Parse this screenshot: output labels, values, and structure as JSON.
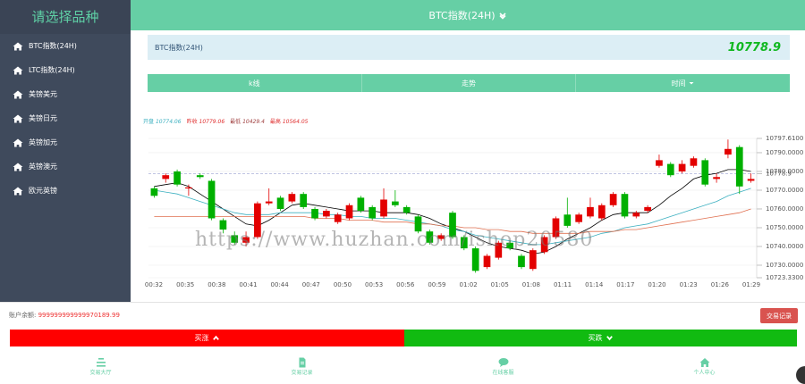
{
  "sidebar": {
    "title": "请选择品种",
    "items": [
      {
        "label": "BTC指数(24H)"
      },
      {
        "label": "LTC指数(24H)"
      },
      {
        "label": "美镑美元"
      },
      {
        "label": "美镑日元"
      },
      {
        "label": "英镑加元"
      },
      {
        "label": "英镑澳元"
      },
      {
        "label": "欧元英镑"
      }
    ]
  },
  "header": {
    "title": "BTC指数(24H)"
  },
  "info": {
    "name": "BTC指数(24H)",
    "price": "10778.9"
  },
  "tabs": [
    {
      "label": "k线"
    },
    {
      "label": "走势"
    },
    {
      "label": "时间"
    }
  ],
  "stats": {
    "open_label": "开盘",
    "open": "10774.06",
    "close_label": "昨收",
    "close": "10779.06",
    "low_label": "最低",
    "low": "10429.4",
    "high_label": "最高",
    "high": "10564.05"
  },
  "chart_data": {
    "type": "candlestick",
    "x_ticks": [
      "00:32",
      "00:35",
      "00:38",
      "00:41",
      "00:44",
      "00:47",
      "00:50",
      "00:53",
      "00:56",
      "00:59",
      "01:02",
      "01:05",
      "01:08",
      "01:11",
      "01:14",
      "01:17",
      "01:20",
      "01:23",
      "01:26",
      "01:29"
    ],
    "y_ticks": [
      "10797.6100",
      "10790.0000",
      "10780.0000",
      "10778.9",
      "10770.0000",
      "10760.0000",
      "10750.0000",
      "10740.0000",
      "10730.0000",
      "10723.3300"
    ],
    "ylim": [
      10723.33,
      10797.61
    ],
    "current": 10778.9,
    "up_color": "#e30000",
    "down_color": "#00b000",
    "candles": [
      {
        "o": 10771,
        "c": 10767,
        "h": 10772,
        "l": 10766
      },
      {
        "o": 10776,
        "c": 10778,
        "h": 10779,
        "l": 10774
      },
      {
        "o": 10780,
        "c": 10773,
        "h": 10781,
        "l": 10772
      },
      {
        "o": 10771,
        "c": 10771.5,
        "h": 10773,
        "l": 10767
      },
      {
        "o": 10778,
        "c": 10777,
        "h": 10779,
        "l": 10776
      },
      {
        "o": 10775,
        "c": 10755,
        "h": 10776,
        "l": 10754
      },
      {
        "o": 10754,
        "c": 10749,
        "h": 10755,
        "l": 10747
      },
      {
        "o": 10746,
        "c": 10742,
        "h": 10748,
        "l": 10741
      },
      {
        "o": 10742,
        "c": 10745,
        "h": 10748,
        "l": 10740
      },
      {
        "o": 10745,
        "c": 10763,
        "h": 10764,
        "l": 10744
      },
      {
        "o": 10763,
        "c": 10764,
        "h": 10771,
        "l": 10762
      },
      {
        "o": 10766,
        "c": 10760,
        "h": 10767,
        "l": 10759
      },
      {
        "o": 10764,
        "c": 10768,
        "h": 10769,
        "l": 10763
      },
      {
        "o": 10768,
        "c": 10761,
        "h": 10769,
        "l": 10760
      },
      {
        "o": 10760,
        "c": 10755,
        "h": 10761,
        "l": 10754
      },
      {
        "o": 10756,
        "c": 10759,
        "h": 10760,
        "l": 10755
      },
      {
        "o": 10753,
        "c": 10757,
        "h": 10758,
        "l": 10752
      },
      {
        "o": 10755,
        "c": 10762,
        "h": 10763,
        "l": 10754
      },
      {
        "o": 10766,
        "c": 10759,
        "h": 10767,
        "l": 10758
      },
      {
        "o": 10761,
        "c": 10755,
        "h": 10762,
        "l": 10754
      },
      {
        "o": 10756,
        "c": 10765,
        "h": 10771,
        "l": 10755
      },
      {
        "o": 10764,
        "c": 10762,
        "h": 10770,
        "l": 10761
      },
      {
        "o": 10761,
        "c": 10758,
        "h": 10762,
        "l": 10757
      },
      {
        "o": 10756,
        "c": 10748,
        "h": 10757,
        "l": 10747
      },
      {
        "o": 10748,
        "c": 10742,
        "h": 10749,
        "l": 10741
      },
      {
        "o": 10744,
        "c": 10746,
        "h": 10747,
        "l": 10743
      },
      {
        "o": 10758,
        "c": 10745,
        "h": 10759,
        "l": 10744
      },
      {
        "o": 10745,
        "c": 10739,
        "h": 10746,
        "l": 10738
      },
      {
        "o": 10739,
        "c": 10727,
        "h": 10740,
        "l": 10726
      },
      {
        "o": 10729,
        "c": 10735,
        "h": 10736,
        "l": 10728
      },
      {
        "o": 10734,
        "c": 10742,
        "h": 10743,
        "l": 10733
      },
      {
        "o": 10742,
        "c": 10739,
        "h": 10743,
        "l": 10738
      },
      {
        "o": 10735,
        "c": 10729,
        "h": 10736,
        "l": 10728
      },
      {
        "o": 10728,
        "c": 10738,
        "h": 10739,
        "l": 10727
      },
      {
        "o": 10737,
        "c": 10745,
        "h": 10746,
        "l": 10736
      },
      {
        "o": 10745,
        "c": 10755,
        "h": 10756,
        "l": 10744
      },
      {
        "o": 10757,
        "c": 10751,
        "h": 10766,
        "l": 10750
      },
      {
        "o": 10753,
        "c": 10757,
        "h": 10758,
        "l": 10752
      },
      {
        "o": 10756,
        "c": 10761,
        "h": 10766,
        "l": 10755
      },
      {
        "o": 10755,
        "c": 10762,
        "h": 10763,
        "l": 10754
      },
      {
        "o": 10762,
        "c": 10768,
        "h": 10769,
        "l": 10761
      },
      {
        "o": 10768,
        "c": 10756,
        "h": 10769,
        "l": 10755
      },
      {
        "o": 10756,
        "c": 10758,
        "h": 10759,
        "l": 10755
      },
      {
        "o": 10759,
        "c": 10761,
        "h": 10762,
        "l": 10758
      },
      {
        "o": 10783,
        "c": 10786,
        "h": 10789,
        "l": 10782
      },
      {
        "o": 10784,
        "c": 10778,
        "h": 10785,
        "l": 10777
      },
      {
        "o": 10780,
        "c": 10784,
        "h": 10786,
        "l": 10779
      },
      {
        "o": 10783,
        "c": 10787,
        "h": 10788,
        "l": 10782
      },
      {
        "o": 10786,
        "c": 10773,
        "h": 10787,
        "l": 10772
      },
      {
        "o": 10776,
        "c": 10777,
        "h": 10779,
        "l": 10774
      },
      {
        "o": 10789,
        "c": 10792,
        "h": 10797,
        "l": 10787
      },
      {
        "o": 10793,
        "c": 10772,
        "h": 10794,
        "l": 10768
      },
      {
        "o": 10775,
        "c": 10776,
        "h": 10779,
        "l": 10774
      }
    ],
    "ma_lines": [
      {
        "color": "#000000",
        "values": [
          10772,
          10773,
          10774,
          10772,
          10768,
          10764,
          10760,
          10756,
          10752,
          10751,
          10754,
          10758,
          10762,
          10763,
          10762,
          10761,
          10760,
          10759,
          10759,
          10759,
          10758,
          10758,
          10758,
          10757,
          10755,
          10752,
          10750,
          10748,
          10745,
          10742,
          10740,
          10739,
          10738,
          10736,
          10737,
          10740,
          10744,
          10747,
          10750,
          10754,
          10757,
          10758,
          10758,
          10758,
          10762,
          10767,
          10771,
          10776,
          10778,
          10779,
          10781,
          10781,
          10780
        ]
      },
      {
        "color": "#3cb0c0",
        "values": [
          10770,
          10769,
          10768,
          10766,
          10764,
          10762,
          10760,
          10758,
          10757,
          10757,
          10757,
          10758,
          10758,
          10758,
          10758,
          10757,
          10757,
          10756,
          10756,
          10755,
          10755,
          10755,
          10754,
          10753,
          10752,
          10751,
          10749,
          10748,
          10746,
          10745,
          10744,
          10743,
          10742,
          10741,
          10741,
          10742,
          10743,
          10744,
          10745,
          10747,
          10748,
          10750,
          10751,
          10752,
          10754,
          10756,
          10758,
          10760,
          10762,
          10764,
          10767,
          10769,
          10771
        ]
      },
      {
        "color": "#e07050",
        "values": [
          10756,
          10756,
          10756,
          10756,
          10756,
          10756,
          10756,
          10756,
          10756,
          10756,
          10756,
          10756,
          10756,
          10756,
          10755,
          10755,
          10755,
          10754,
          10754,
          10754,
          10753,
          10753,
          10753,
          10752,
          10752,
          10751,
          10751,
          10750,
          10750,
          10749,
          10749,
          10748,
          10748,
          10747,
          10747,
          10747,
          10747,
          10747,
          10748,
          10748,
          10748,
          10749,
          10749,
          10750,
          10751,
          10752,
          10753,
          10754,
          10755,
          10756,
          10757,
          10758,
          10760
        ]
      }
    ]
  },
  "account": {
    "balance_label": "账户余额:",
    "balance": "999999999999970189.99"
  },
  "history_btn": "交易记录",
  "buy_up": {
    "label": "买涨"
  },
  "buy_down": {
    "label": "买跌"
  },
  "footer": [
    {
      "label": "交易大厅",
      "icon": "list-icon"
    },
    {
      "label": "交易记录",
      "icon": "document-icon"
    },
    {
      "label": "在线客服",
      "icon": "chat-icon"
    },
    {
      "label": "个人中心",
      "icon": "home-icon"
    }
  ],
  "watermark": "https://www.huzhan.com/ishop20580"
}
